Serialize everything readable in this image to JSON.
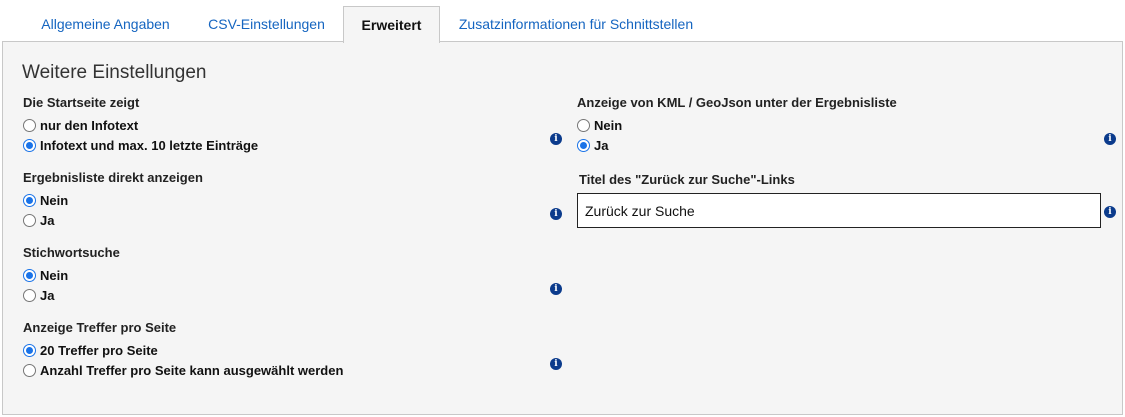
{
  "tabs": [
    {
      "label": "Allgemeine Angaben"
    },
    {
      "label": "CSV-Einstellungen"
    },
    {
      "label": "Erweitert"
    },
    {
      "label": "Zusatzinformationen für Schnittstellen"
    }
  ],
  "section_title": "Weitere Einstellungen",
  "startseite": {
    "label": "Die Startseite zeigt",
    "options": [
      "nur den Infotext",
      "Infotext und max. 10 letzte Einträge"
    ],
    "selected": 1
  },
  "ergebnisliste": {
    "label": "Ergebnisliste direkt anzeigen",
    "options": [
      "Nein",
      "Ja"
    ],
    "selected": 0
  },
  "stichwortsuche": {
    "label": "Stichwortsuche",
    "options": [
      "Nein",
      "Ja"
    ],
    "selected": 0
  },
  "treffer": {
    "label": "Anzeige Treffer pro Seite",
    "options": [
      "20 Treffer pro Seite",
      "Anzahl Treffer pro Seite kann ausgewählt werden"
    ],
    "selected": 0
  },
  "kml": {
    "label": "Anzeige von KML / GeoJson unter der Ergebnisliste",
    "options": [
      "Nein",
      "Ja"
    ],
    "selected": 1
  },
  "zurueck": {
    "label": "Titel des \"Zurück zur Suche\"-Links",
    "value": "Zurück zur Suche"
  },
  "info_glyph": "i",
  "icons": {
    "info": "info-circle-icon"
  },
  "colors": {
    "link": "#1565c0",
    "info": "#0b3b8c",
    "radio": "#1a73e8",
    "panel": "#f5f5f5"
  }
}
